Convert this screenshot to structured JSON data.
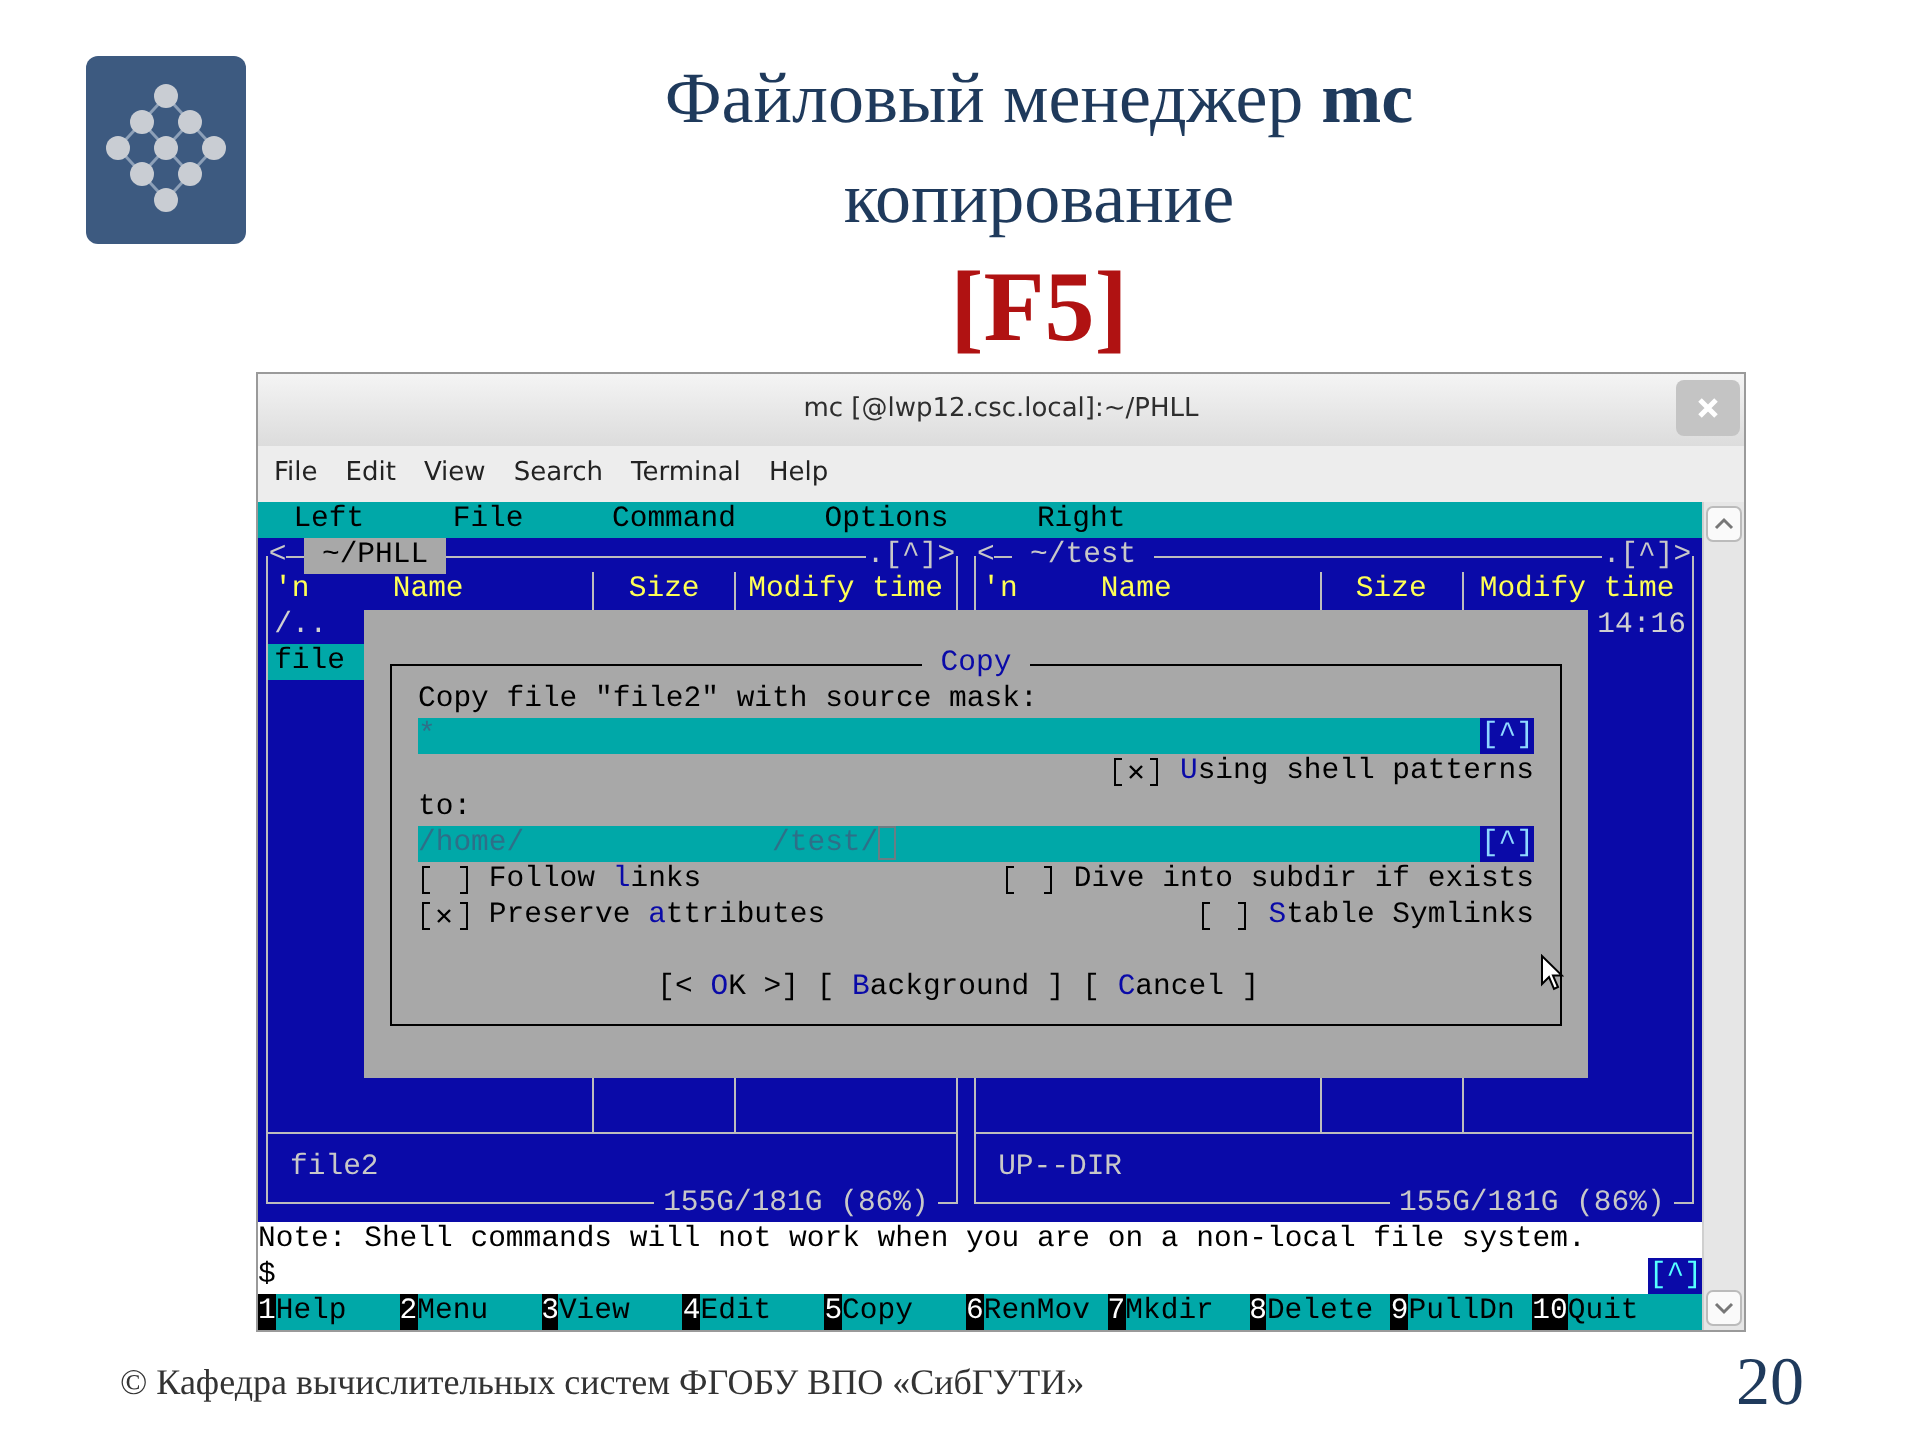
{
  "slide": {
    "title": "Файловый менеджер **mc**",
    "subtitle": "копирование",
    "key": "[F5]",
    "footer": "© Кафедра вычислительных систем ФГОБУ ВПО «СибГУТИ»",
    "page_number": "20"
  },
  "window": {
    "title": "mc [@lwp12.csc.local]:~/PHLL",
    "menu": [
      "File",
      "Edit",
      "View",
      "Search",
      "Terminal",
      "Help"
    ]
  },
  "mc": {
    "menu_bar": [
      "Left",
      "File",
      "Command",
      "Options",
      "Right"
    ],
    "panels": [
      {
        "open": "<",
        "path": "~/PHLL",
        "active": true,
        "more": ".[^]>",
        "columns": [
          "'n",
          "Name",
          "Size",
          "Modify time"
        ],
        "rows": [
          {
            "name": "/..",
            "selected": false
          },
          {
            "name": "file",
            "selected": true
          }
        ],
        "mini_status": "file2",
        "disk": "155G/181G (86%)"
      },
      {
        "open": "<",
        "path": "~/test",
        "active": false,
        "more": ".[^]>",
        "columns": [
          "'n",
          "Name",
          "Size",
          "Modify time"
        ],
        "rows": [
          {
            "time": "14:16",
            "selected": false
          }
        ],
        "mini_status": "UP--DIR",
        "disk": "155G/181G (86%)"
      }
    ],
    "dialog": {
      "title": "Copy",
      "source_label": "Copy file \"file2\" with source mask:",
      "source_value": "*",
      "source_history": "[^]",
      "shell_patterns": {
        "checked": true,
        "hot": "U",
        "post": "sing shell patterns"
      },
      "to_label": "to:",
      "dest_value": "/home/              /test/",
      "dest_history": "[^]",
      "options": [
        {
          "left": {
            "checked": false,
            "pre": "Follow ",
            "hot": "l",
            "post": "inks"
          },
          "right": {
            "checked": false,
            "pre": "Dive into subdir if exists"
          }
        },
        {
          "left": {
            "checked": true,
            "pre": "Preserve ",
            "hot": "a",
            "post": "ttributes"
          },
          "right": {
            "checked": false,
            "hot": "S",
            "post": "table Symlinks"
          }
        }
      ],
      "buttons": [
        {
          "pre": "[< ",
          "hot": "O",
          "post": "K >]"
        },
        {
          "pre": "[ ",
          "hot": "B",
          "post": "ackground ]"
        },
        {
          "pre": "[ ",
          "hot": "C",
          "post": "ancel ]"
        }
      ]
    },
    "note": "Note: Shell commands will not work when you are on a non-local file system.",
    "prompt": "$",
    "prompt_history": "[^]",
    "function_keys": [
      {
        "key": "1",
        "label": "Help"
      },
      {
        "key": "2",
        "label": "Menu"
      },
      {
        "key": "3",
        "label": "View"
      },
      {
        "key": "4",
        "label": "Edit"
      },
      {
        "key": "5",
        "label": "Copy"
      },
      {
        "key": "6",
        "label": "RenMov"
      },
      {
        "key": "7",
        "label": "Mkdir"
      },
      {
        "key": "8",
        "label": "Delete"
      },
      {
        "key": "9",
        "label": "PullDn"
      },
      {
        "key": "10",
        "label": "Quit"
      }
    ]
  }
}
